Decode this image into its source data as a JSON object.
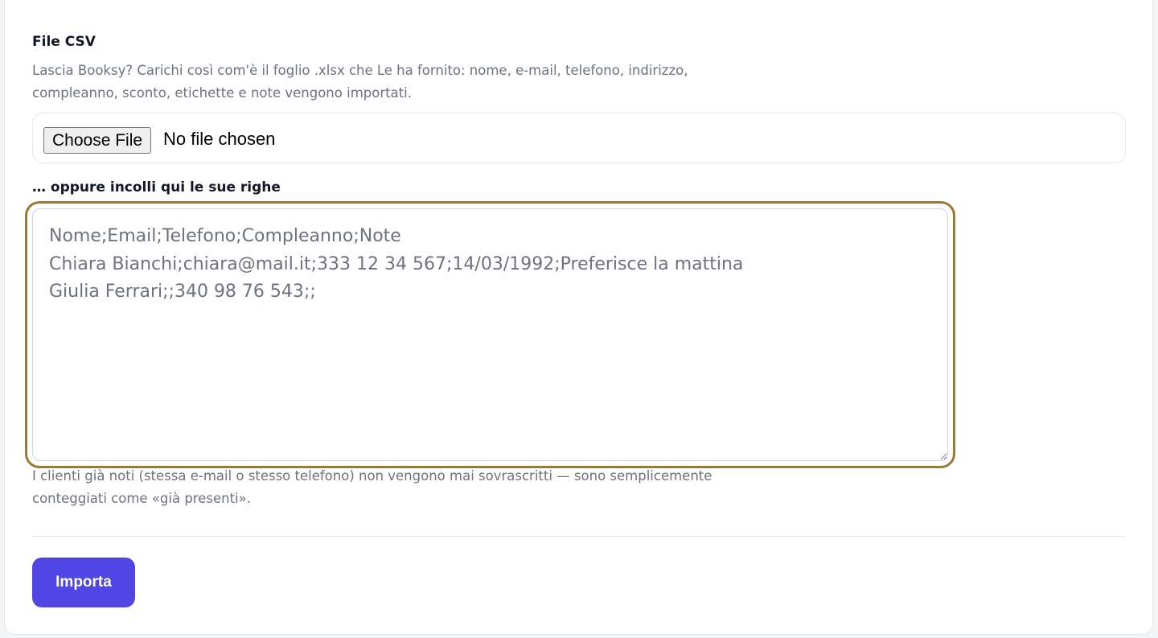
{
  "csv_section": {
    "label": "File CSV",
    "help": "Lascia Booksy? Carichi così com'è il foglio .xlsx che Le ha fornito: nome, e-mail, telefono, indirizzo, compleanno, sconto, etichette e note vengono importati.",
    "choose_file_label": "Choose File",
    "file_status": "No file chosen"
  },
  "paste_section": {
    "label": "… oppure incolli qui le sue righe",
    "placeholder": "Nome;Email;Telefono;Compleanno;Note\nChiara Bianchi;chiara@mail.it;333 12 34 567;14/03/1992;Preferisce la mattina\nGiulia Ferrari;;340 98 76 543;;",
    "value": "",
    "help": "I clienti già noti (stessa e-mail o stesso telefono) non vengono mai sovrascritti — sono semplicemente conteggiati come «già presenti»."
  },
  "actions": {
    "import_label": "Importa"
  },
  "colors": {
    "accent": "#4f46e5",
    "focus_ring": "#9c7a36",
    "help_text": "#6b7280"
  }
}
